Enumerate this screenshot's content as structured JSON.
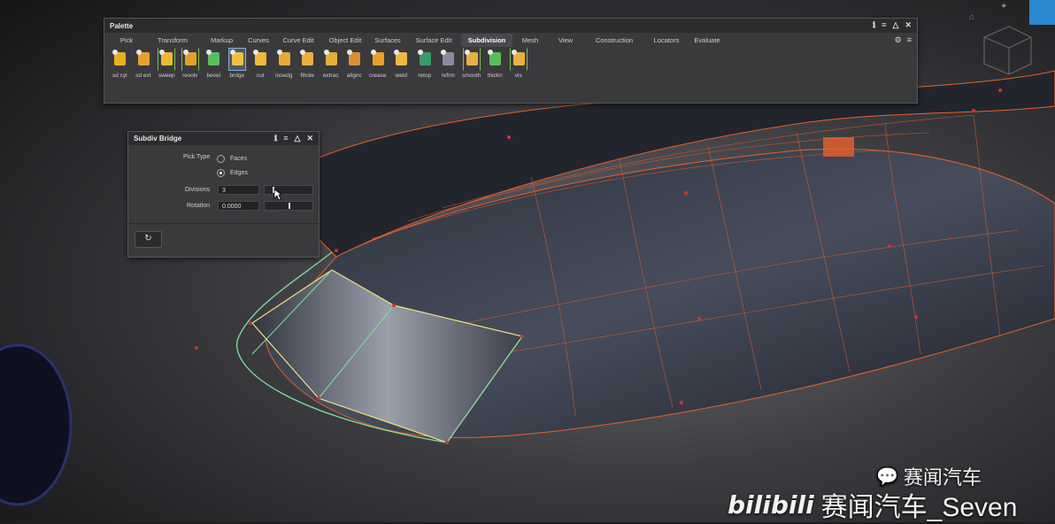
{
  "palette": {
    "title": "Palette",
    "tabs": [
      "Pick",
      "Transform",
      "Markup",
      "Curves",
      "Curve Edit",
      "Object Edit",
      "Surfaces",
      "Surface Edit",
      "Subdivision",
      "Mesh",
      "View",
      "Construction",
      "Locators",
      "Evaluate"
    ],
    "active_tab": "Subdivision",
    "tools": [
      {
        "label": "sd cyl",
        "icon": "subdiv-cylinder-icon",
        "color": "#e8b020"
      },
      {
        "label": "sd ext",
        "icon": "subdiv-extrude-icon",
        "color": "#e8a030"
      },
      {
        "label": "sweep",
        "icon": "sweep-icon",
        "color": "#f0b830"
      },
      {
        "label": "revolv",
        "icon": "revolve-icon",
        "color": "#e0a028"
      },
      {
        "label": "bevel",
        "icon": "bevel-icon",
        "color": "#5bbd5b"
      },
      {
        "label": "brdge",
        "icon": "bridge-icon",
        "color": "#f0c040"
      },
      {
        "label": "cut",
        "icon": "cut-icon",
        "color": "#f0b838"
      },
      {
        "label": "insedg",
        "icon": "insert-edge-icon",
        "color": "#e8a838"
      },
      {
        "label": "fihole",
        "icon": "fill-hole-icon",
        "color": "#e8b040"
      },
      {
        "label": "extrac",
        "icon": "extract-icon",
        "color": "#e0b038"
      },
      {
        "label": "alignc",
        "icon": "align-icon",
        "color": "#d89038"
      },
      {
        "label": "crease",
        "icon": "crease-icon",
        "color": "#e8a028"
      },
      {
        "label": "weld",
        "icon": "weld-icon",
        "color": "#f0b840"
      },
      {
        "label": "retop",
        "icon": "retopology-icon",
        "color": "#3a9a6a"
      },
      {
        "label": "refrm",
        "icon": "reform-icon",
        "color": "#8a8aa0"
      },
      {
        "label": "smooth",
        "icon": "smooth-icon",
        "color": "#e8b040"
      },
      {
        "label": "thickn",
        "icon": "thicken-icon",
        "color": "#5bbd5b"
      },
      {
        "label": "vis",
        "icon": "visibility-icon",
        "color": "#e8b040"
      }
    ]
  },
  "bridge": {
    "title": "Subdiv Bridge",
    "pick_type_label": "Pick Type",
    "option_faces": "Faces",
    "option_edges": "Edges",
    "selected_option": "Edges",
    "divisions_label": "Divisions",
    "divisions_value": "3",
    "rotation_label": "Rotation",
    "rotation_value": "0.0000"
  },
  "watermark": {
    "wechat_text": "赛闻汽车",
    "bilibili_text": "赛闻汽车_Seven",
    "bilibili_logo": "bilibili"
  },
  "colors": {
    "wire_orange": "#e8602a",
    "wire_green": "#7fe0a0",
    "wire_yellow": "#f0e080",
    "accent_select": "#8ab4d8"
  }
}
